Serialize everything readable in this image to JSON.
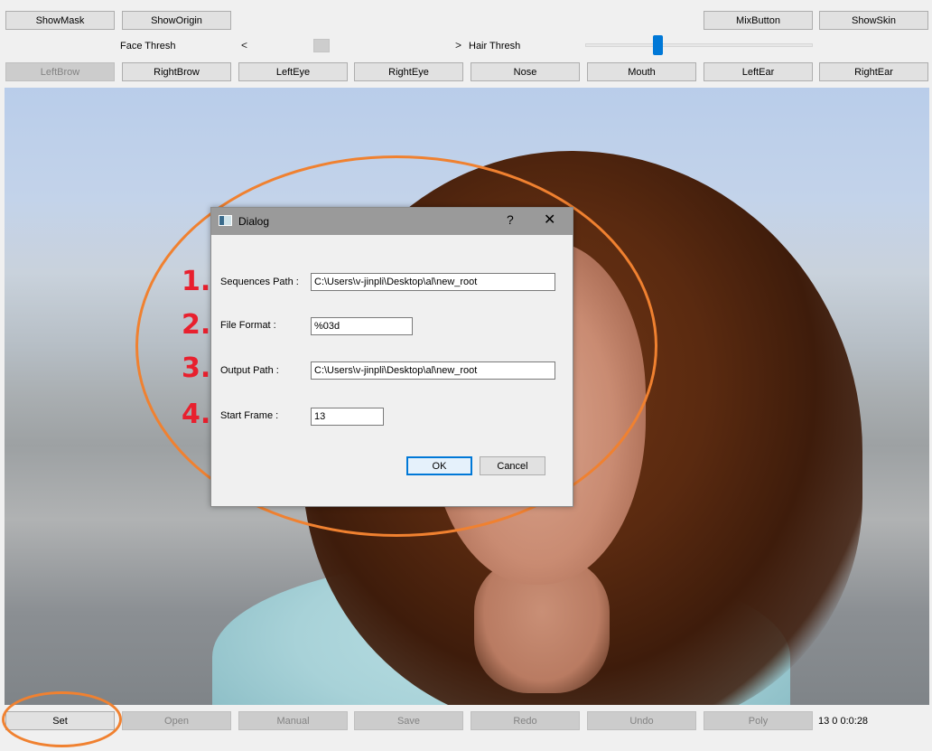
{
  "top_toolbar": {
    "show_mask": "ShowMask",
    "show_origin": "ShowOrigin",
    "mix_button": "MixButton",
    "show_skin": "ShowSkin"
  },
  "sliders": {
    "face_thresh_label": "Face Thresh",
    "face_thresh_value": 0.34,
    "hair_thresh_label": "Hair Thresh",
    "hair_thresh_value": 0.31
  },
  "region_buttons": [
    "LeftBrow",
    "RightBrow",
    "LeftEye",
    "RightEye",
    "Nose",
    "Mouth",
    "LeftEar",
    "RightEar"
  ],
  "annotations": {
    "steps": [
      "1.",
      "2.",
      "3.",
      "4."
    ],
    "color": "#f08130",
    "number_color": "#e8202e"
  },
  "dialog": {
    "title": "Dialog",
    "help": "?",
    "close": "✕",
    "sequences_path_label": "Sequences Path :",
    "sequences_path_value": "C:\\Users\\v-jinpli\\Desktop\\al\\new_root",
    "file_format_label": "File Format :",
    "file_format_value": "%03d",
    "output_path_label": "Output Path :",
    "output_path_value": "C:\\Users\\v-jinpli\\Desktop\\al\\new_root",
    "start_frame_label": "Start Frame :",
    "start_frame_value": "13",
    "ok": "OK",
    "cancel": "Cancel"
  },
  "bottom_toolbar": {
    "set": "Set",
    "open": "Open",
    "manual": "Manual",
    "save": "Save",
    "redo": "Redo",
    "undo": "Undo",
    "poly": "Poly",
    "status": "13  0  0:0:28"
  }
}
